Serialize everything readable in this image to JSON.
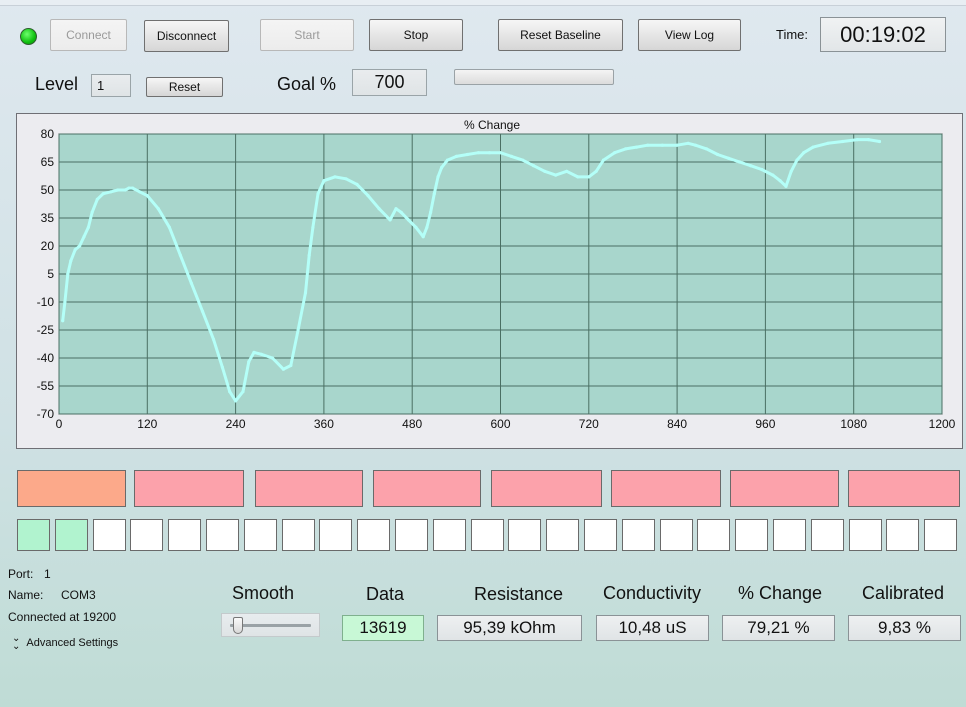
{
  "toolbar": {
    "connect_label": "Connect",
    "disconnect_label": "Disconnect",
    "start_label": "Start",
    "stop_label": "Stop",
    "reset_baseline_label": "Reset Baseline",
    "view_log_label": "View Log",
    "time_label": "Time:",
    "time_value": "00:19:02"
  },
  "level": {
    "label": "Level",
    "value": "1",
    "reset_label": "Reset"
  },
  "goal": {
    "label": "Goal %",
    "value": "700",
    "progress": 0
  },
  "chart_data": {
    "type": "line",
    "title": "% Change",
    "xlabel": "",
    "ylabel": "",
    "xlim": [
      0,
      1200
    ],
    "ylim": [
      -70,
      80
    ],
    "x_ticks": [
      "0",
      "120",
      "240",
      "360",
      "480",
      "600",
      "720",
      "840",
      "960",
      "1080",
      "1200"
    ],
    "y_ticks": [
      "80",
      "65",
      "50",
      "35",
      "20",
      "5",
      "-10",
      "-25",
      "-40",
      "-55",
      "-70"
    ],
    "grid": true,
    "line_color": "#b4fff8",
    "plot_bg": "#a8d6cc",
    "series": [
      {
        "values": [
          [
            5,
            -20
          ],
          [
            8,
            -10
          ],
          [
            12,
            5
          ],
          [
            16,
            12
          ],
          [
            22,
            18
          ],
          [
            28,
            20
          ],
          [
            34,
            25
          ],
          [
            40,
            30
          ],
          [
            45,
            38
          ],
          [
            52,
            45
          ],
          [
            60,
            48
          ],
          [
            70,
            49
          ],
          [
            80,
            50
          ],
          [
            90,
            50
          ],
          [
            95,
            51
          ],
          [
            100,
            51
          ],
          [
            110,
            49
          ],
          [
            120,
            47
          ],
          [
            135,
            40
          ],
          [
            150,
            30
          ],
          [
            165,
            15
          ],
          [
            180,
            0
          ],
          [
            195,
            -15
          ],
          [
            210,
            -30
          ],
          [
            222,
            -45
          ],
          [
            232,
            -58
          ],
          [
            240,
            -63
          ],
          [
            250,
            -58
          ],
          [
            258,
            -42
          ],
          [
            265,
            -37
          ],
          [
            275,
            -38
          ],
          [
            290,
            -40
          ],
          [
            305,
            -46
          ],
          [
            315,
            -44
          ],
          [
            325,
            -25
          ],
          [
            335,
            -5
          ],
          [
            340,
            15
          ],
          [
            345,
            30
          ],
          [
            352,
            48
          ],
          [
            360,
            55
          ],
          [
            375,
            57
          ],
          [
            390,
            56
          ],
          [
            405,
            53
          ],
          [
            420,
            47
          ],
          [
            435,
            40
          ],
          [
            450,
            34
          ],
          [
            458,
            40
          ],
          [
            465,
            38
          ],
          [
            475,
            34
          ],
          [
            485,
            30
          ],
          [
            495,
            25
          ],
          [
            500,
            30
          ],
          [
            505,
            38
          ],
          [
            510,
            48
          ],
          [
            515,
            57
          ],
          [
            520,
            62
          ],
          [
            528,
            66
          ],
          [
            540,
            68
          ],
          [
            555,
            69
          ],
          [
            570,
            70
          ],
          [
            585,
            70
          ],
          [
            600,
            70
          ],
          [
            615,
            68
          ],
          [
            630,
            66
          ],
          [
            645,
            63
          ],
          [
            660,
            60
          ],
          [
            675,
            58
          ],
          [
            690,
            60
          ],
          [
            705,
            57
          ],
          [
            720,
            57
          ],
          [
            730,
            60
          ],
          [
            740,
            66
          ],
          [
            755,
            70
          ],
          [
            770,
            72
          ],
          [
            785,
            73
          ],
          [
            800,
            74
          ],
          [
            820,
            74
          ],
          [
            840,
            74
          ],
          [
            855,
            75
          ],
          [
            865,
            74
          ],
          [
            880,
            72
          ],
          [
            895,
            69
          ],
          [
            910,
            67
          ],
          [
            925,
            65
          ],
          [
            940,
            63
          ],
          [
            955,
            61
          ],
          [
            970,
            58
          ],
          [
            980,
            55
          ],
          [
            988,
            52
          ],
          [
            995,
            60
          ],
          [
            1003,
            66
          ],
          [
            1012,
            70
          ],
          [
            1025,
            73
          ],
          [
            1045,
            75
          ],
          [
            1065,
            76
          ],
          [
            1085,
            77
          ],
          [
            1100,
            77
          ],
          [
            1115,
            76
          ]
        ]
      }
    ]
  },
  "zones": [
    "",
    "",
    "",
    "",
    "",
    "",
    "",
    ""
  ],
  "cells_lit": 2,
  "cells_total": 25,
  "port": {
    "port_label": "Port:",
    "port_value": "1",
    "name_label": "Name:",
    "name_value": "COM3",
    "status": "Connected at 19200",
    "advanced": "Advanced Settings"
  },
  "metrics": {
    "smooth_label": "Smooth",
    "smooth_value": 0.05,
    "data_label": "Data",
    "data_value": "13619",
    "resistance_label": "Resistance",
    "resistance_value": "95,39 kOhm",
    "conductivity_label": "Conductivity",
    "conductivity_value": "10,48 uS",
    "change_label": "% Change",
    "change_value": "79,21 %",
    "calibrated_label": "Calibrated",
    "calibrated_value": "9,83 %"
  }
}
